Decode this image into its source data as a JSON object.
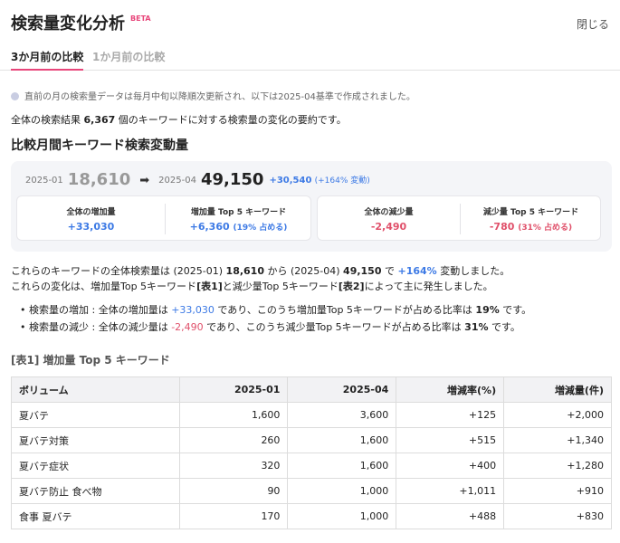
{
  "header": {
    "title": "検索量変化分析",
    "beta": "BETA",
    "close_label": "閉じる"
  },
  "tabs": [
    {
      "label": "3か月前の比較"
    },
    {
      "label": "1か月前の比較"
    }
  ],
  "notice": "直前の月の検索量データは毎月中旬以降順次更新され、以下は2025-04基準で作成されました。",
  "summary": {
    "prefix": "全体の検索結果",
    "count": "6,367",
    "suffix": "個のキーワードに対する検索量の変化の要約です。"
  },
  "section_title": "比較月間キーワード検索変動量",
  "comparison": {
    "from_period": "2025-01",
    "from_value": "18,610",
    "to_period": "2025-04",
    "to_value": "49,150",
    "change": "+30,540",
    "change_pct": "(+164% 変動)",
    "increase": {
      "total_label": "全体の増加量",
      "total_value": "+33,030",
      "top_label": "増加量 Top 5 キーワード",
      "top_value": "+6,360",
      "top_share": "(19% 占める)"
    },
    "decrease": {
      "total_label": "全体の減少量",
      "total_value": "-2,490",
      "top_label": "減少量 Top 5 キーワード",
      "top_value": "-780",
      "top_share": "(31% 占める)"
    },
    "colors": {
      "increase": "#3d7ae5",
      "decrease": "#e0506a"
    }
  },
  "description": {
    "line1": {
      "a": "これらのキーワードの全体検索量は (2025-01) ",
      "from": "18,610",
      "b": " から (2025-04) ",
      "to": "49,150",
      "c": " で ",
      "pct": "+164%",
      "d": " 変動しました。"
    },
    "line2": {
      "a": "これらの変化は、増加量Top 5キーワード",
      "t1": "[表1]",
      "b": "と減少量Top 5キーワード",
      "t2": "[表2]",
      "c": "によって主に発生しました。"
    },
    "bullet1": {
      "a": "検索量の増加 : 全体の増加量は ",
      "val": "+33,030",
      "b": " であり、このうち増加量Top 5キーワードが占める比率は ",
      "pct": "19%",
      "c": " です。"
    },
    "bullet2": {
      "a": "検索量の減少 : 全体の減少量は ",
      "val": "-2,490",
      "b": " であり、このうち減少量Top 5キーワードが占める比率は ",
      "pct": "31%",
      "c": " です。"
    }
  },
  "table1": {
    "title": "[表1] 増加量 Top 5 キーワード",
    "headers": [
      "ボリューム",
      "2025-01",
      "2025-04",
      "増減率(%)",
      "増減量(件)"
    ],
    "rows": [
      [
        "夏バテ",
        "1,600",
        "3,600",
        "+125",
        "+2,000"
      ],
      [
        "夏バテ対策",
        "260",
        "1,600",
        "+515",
        "+1,340"
      ],
      [
        "夏バテ症状",
        "320",
        "1,600",
        "+400",
        "+1,280"
      ],
      [
        "夏バテ防止 食べ物",
        "90",
        "1,000",
        "+1,011",
        "+910"
      ],
      [
        "食事 夏バテ",
        "170",
        "1,000",
        "+488",
        "+830"
      ]
    ]
  }
}
